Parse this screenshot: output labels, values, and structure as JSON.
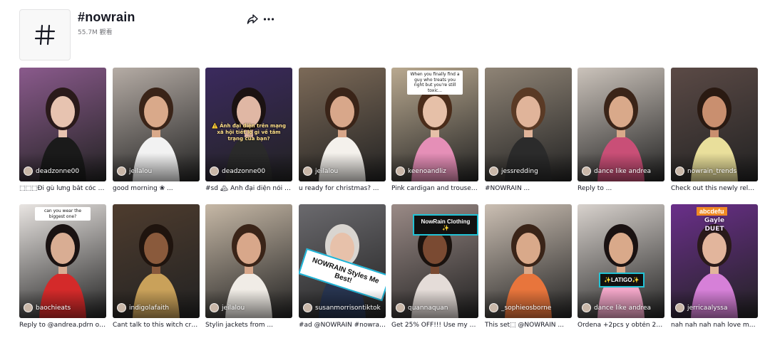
{
  "header": {
    "title": "#nowrain",
    "views": "55.7M 觀看",
    "icon": "hashtag-icon",
    "share_icon": "share-icon",
    "more_icon": "more-icon"
  },
  "videos": [
    {
      "author": "deadzonne00",
      "caption": "⬚⬚⬚Đi gù lưng bắt cóc cho ...",
      "bg": "#8a5a8c",
      "skin": "#e7c3b0",
      "hair": "#2a1a1a",
      "shirt": "#1a1a1a"
    },
    {
      "author": "jeilalou",
      "caption": "good morning ❀ ...",
      "bg": "#b5aca5",
      "skin": "#d9a98a",
      "hair": "#3a2418",
      "shirt": "#f2f2f2"
    },
    {
      "author": "deadzonne00",
      "caption": "#sd 🏔 Ảnh đại diện nói gì ...",
      "bg": "#3b2a5e",
      "skin": "#e0b7a4",
      "hair": "#1b1212",
      "shirt": "#2a2a2a",
      "overlay": "⚠️ Ảnh đại diện\ntrên mạng xã hội\ntiết lộ gì về tâm trạng của bạn?"
    },
    {
      "author": "jeilalou",
      "caption": "u ready for christmas? ...",
      "bg": "#7c6a58",
      "skin": "#d8a78a",
      "hair": "#3a2418",
      "shirt": "#f4f1ec"
    },
    {
      "author": "keenoandliz",
      "caption": "Pink cardigan and trousers ...",
      "bg": "#b9a990",
      "skin": "#e6c0a8",
      "hair": "#4a2c1a",
      "shirt": "#e58fb7",
      "overlay_light": "When you finally find a guy who treats you right but you're still toxic..."
    },
    {
      "author": "jessredding",
      "caption": "#NOWRAIN ...",
      "bg": "#8f8476",
      "skin": "#e0b49a",
      "hair": "#5a3a25",
      "shirt": "#2b2b2b"
    },
    {
      "author": "dance like andrea",
      "caption": "Reply to ...",
      "bg": "#cbc3bb",
      "skin": "#d9a98a",
      "hair": "#3a2418",
      "shirt": "#c94f77"
    },
    {
      "author": "nowrain_trends",
      "caption": "Check out this newly relea...",
      "bg": "#5b4a46",
      "skin": "#c98f6f",
      "hair": "#2a1a12",
      "shirt": "#e9df9b"
    },
    {
      "author": "baochieats",
      "caption": "Reply to @andrea.pdrn out...",
      "bg": "#e9e5e2",
      "skin": "#d9ad93",
      "hair": "#1a1212",
      "shirt": "#d42a2a",
      "overlay_light": "can you wear the biggest one?"
    },
    {
      "author": "indigolafaith",
      "caption": "Cant talk to this witch crazy...",
      "bg": "#4e3c2e",
      "skin": "#8a5a3c",
      "hair": "#1f140e",
      "shirt": "#c9a15a"
    },
    {
      "author": "jeilalou",
      "caption": "Stylin jackets from ...",
      "bg": "#c6b8a6",
      "skin": "#d8a78a",
      "hair": "#3a2418",
      "shirt": "#f0ece6"
    },
    {
      "author": "susanmorrisontiktok",
      "caption": "#ad @NOWRAIN #nowrain...",
      "bg": "#6b6a6e",
      "skin": "#e7c1aa",
      "hair": "#d9d5d0",
      "shirt": "#27344f",
      "banner": "NOWRAIN Styles Me Best!"
    },
    {
      "author": "quannaquan",
      "caption": "Get 25% OFF!!! Use my cod...",
      "bg": "#9a8a86",
      "skin": "#7a4a32",
      "hair": "#1a120e",
      "shirt": "#e4dcd8",
      "banner_small": "NowRain Clothing ✨"
    },
    {
      "author": "_sophieosborne",
      "caption": "This set⬚ @NOWRAIN ...",
      "bg": "#cbbfb3",
      "skin": "#d9a98a",
      "hair": "#3a2418",
      "shirt": "#e8753c"
    },
    {
      "author": "dance like andrea",
      "caption": "Ordena +2pcs y obtén 25%...",
      "bg": "#d8d2cd",
      "skin": "#d9a98a",
      "hair": "#1a1212",
      "shirt": "#f2a6c8",
      "banner_small": "✨LATIGO✨"
    },
    {
      "author": "jerricaalyssa",
      "caption": "nah nah nah nah love my ...",
      "bg": "#6a2f8a",
      "skin": "#e2b59c",
      "hair": "#2a1a1a",
      "shirt": "#d680d8",
      "overlay_top": "abcdefu",
      "overlay_sub": "Gayle\nDUET"
    }
  ]
}
